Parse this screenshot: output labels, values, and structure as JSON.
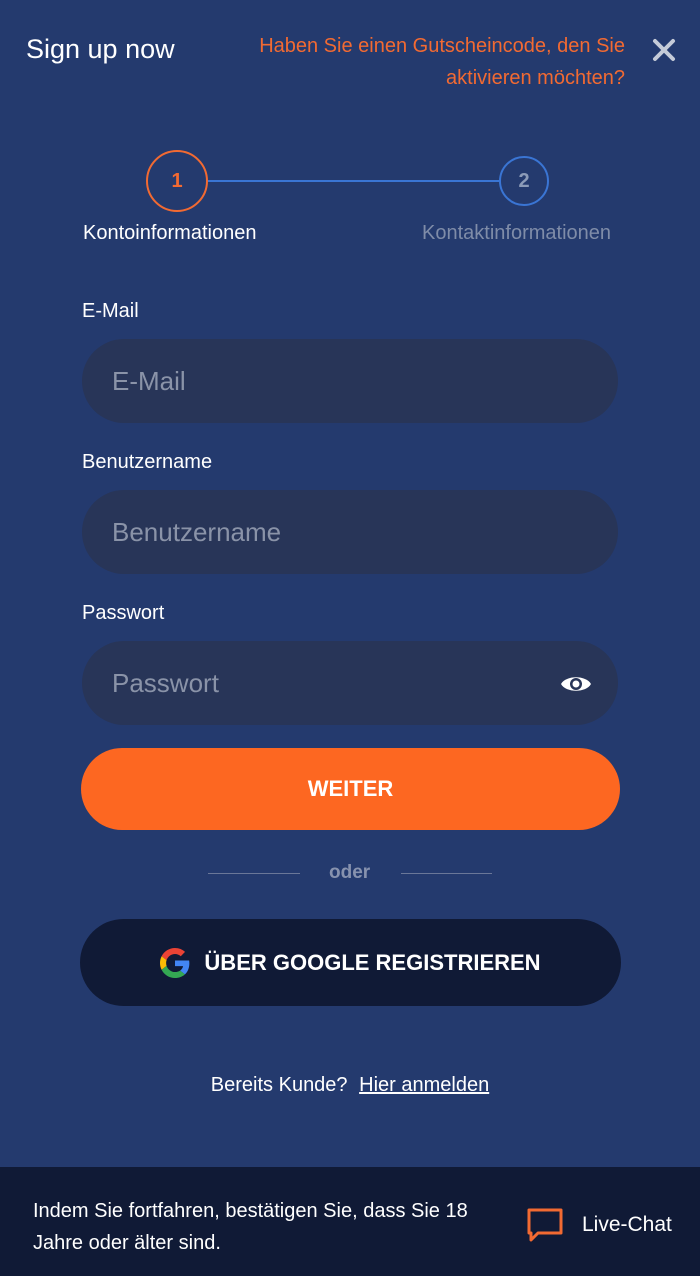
{
  "header": {
    "title": "Sign up now",
    "voucher_link": "Haben Sie einen Gutscheincode, den Sie aktivieren möchten?",
    "close_icon": "close-icon"
  },
  "stepper": {
    "steps": [
      {
        "number": "1",
        "label": "Kontoinformationen",
        "state": "active"
      },
      {
        "number": "2",
        "label": "Kontaktinformationen",
        "state": "inactive"
      }
    ]
  },
  "form": {
    "email": {
      "label": "E-Mail",
      "placeholder": "E-Mail",
      "value": ""
    },
    "username": {
      "label": "Benutzername",
      "placeholder": "Benutzername",
      "value": ""
    },
    "password": {
      "label": "Passwort",
      "placeholder": "Passwort",
      "value": "",
      "toggle_icon": "eye-icon"
    },
    "submit_label": "WEITER",
    "divider_text": "oder",
    "google_label": "ÜBER GOOGLE REGISTRIEREN"
  },
  "login": {
    "prompt": "Bereits Kunde?",
    "link": "Hier anmelden"
  },
  "footer": {
    "disclaimer": "Indem Sie fortfahren, bestätigen Sie, dass Sie 18 Jahre oder älter sind.",
    "live_chat_label": "Live-Chat",
    "chat_icon": "chat-bubble-icon"
  },
  "colors": {
    "background": "#243a6e",
    "accent": "#fd6721",
    "input_bg": "#283558",
    "dark_button": "#101a36"
  }
}
